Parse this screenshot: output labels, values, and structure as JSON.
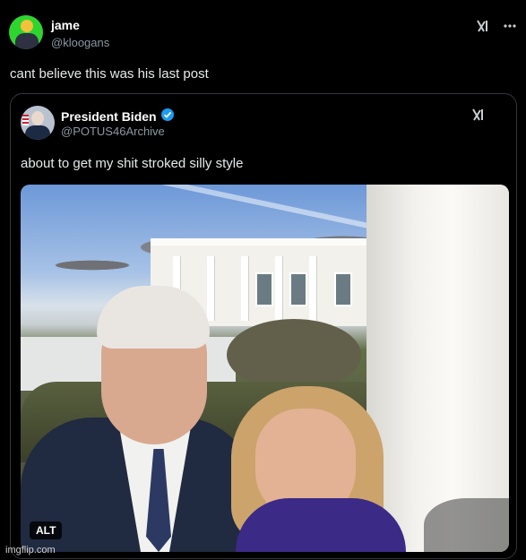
{
  "post": {
    "author_name": "jame",
    "author_handle": "@kloogans",
    "text": "cant believe this was his last post"
  },
  "quote": {
    "author_name": "President Biden",
    "author_handle": "@POTUS46Archive",
    "text": "about to get my shit stroked silly style",
    "media_alt_badge": "ALT"
  },
  "icons": {
    "grok": "grok-icon",
    "more": "more-icon",
    "verified": "verified-badge-icon"
  },
  "colors": {
    "background": "#000000",
    "text": "#e7e9ea",
    "secondary_text": "#8b98a5",
    "border": "#333639",
    "verified": "#1d9bf0"
  },
  "watermark": "imgflip.com"
}
